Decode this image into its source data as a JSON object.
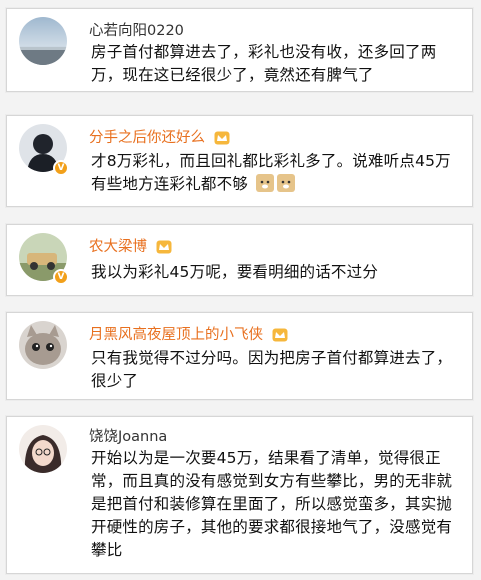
{
  "comments": [
    {
      "username": "心若向阳0220",
      "vip": false,
      "verified": false,
      "text": "房子首付都算进去了，彩礼也没有收，还多回了两万，现在这已经很少了，竟然还有脾气了"
    },
    {
      "username": "分手之后你还好么",
      "vip": true,
      "verified": true,
      "text": "才8万彩礼，而且回礼都比彩礼多了。说难听点45万有些地方连彩礼都不够"
    },
    {
      "username": "农大梁博",
      "vip": true,
      "verified": true,
      "text": "我以为彩礼45万呢，要看明细的话不过分"
    },
    {
      "username": "月黑风高夜屋顶上的小飞侠",
      "vip": true,
      "verified": false,
      "text": "只有我觉得不过分吗。因为把房子首付都算进去了，很少了"
    },
    {
      "username": "饶饶Joanna",
      "vip": false,
      "verified": false,
      "text": "开始以为是一次要45万，结果看了清单，觉得很正常，而且真的没有感觉到女方有些攀比，男的无非就是把首付和装修算在里面了，所以感觉蛮多，其实抛开硬性的房子，其他的要求都很接地气了，没感觉有攀比"
    }
  ],
  "colors": {
    "vip_name": "#e8701f",
    "normal_name": "#333333",
    "badge": "#f2a01a"
  }
}
